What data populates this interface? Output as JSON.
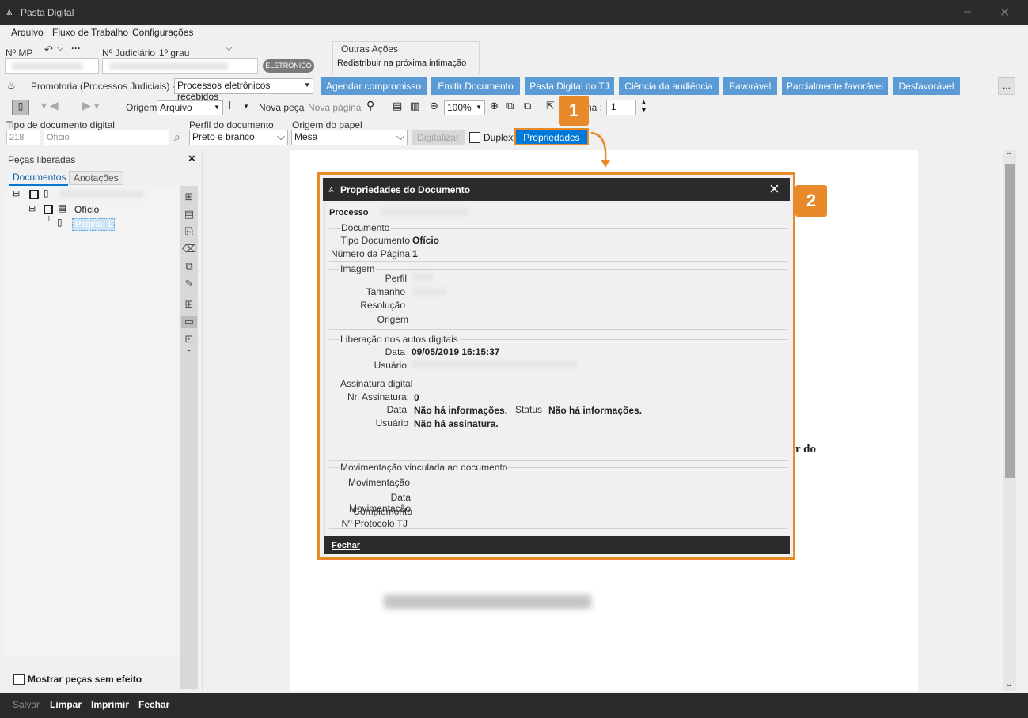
{
  "window": {
    "title": "Pasta Digital"
  },
  "menu": [
    "Arquivo",
    "Fluxo de Trabalho",
    "Configurações"
  ],
  "header": {
    "mp_label": "Nº MP",
    "judicial_label": "Nº Judiciário",
    "grau": "1º grau",
    "eletronico": "ELETRÔNICO",
    "outras_acoes_title": "Outras Ações",
    "outras_acoes_item": "Redistribuir na próxima intimação"
  },
  "queue": {
    "label": "Promotoria (Processos Judiciais) - Fila",
    "value": "Processos eletrônicos recebidos"
  },
  "actions": [
    "Agendar compromisso",
    "Emitir Documento",
    "Pasta Digital do TJ",
    "Ciência da audiência",
    "Favorável",
    "Parcialmente favorável",
    "Desfavorável"
  ],
  "more": "...",
  "toolbar": {
    "origem_label": "Origem",
    "origem_value": "Arquivo",
    "nova_peca": "Nova peça",
    "nova_pagina": "Nova página",
    "zoom": "100%",
    "pagina_label": "na :",
    "pagina_value": "1"
  },
  "docbar": {
    "tipo_label": "Tipo de documento digital",
    "tipo_code": "218",
    "tipo_value": "Ofício",
    "perfil_label": "Perfil do documento",
    "perfil_value": "Preto e branco",
    "origem_label": "Origem do papel",
    "origem_value": "Mesa",
    "digitalizar": "Digitalizar",
    "duplex": "Duplex",
    "propriedades": "Propriedades"
  },
  "sidebar": {
    "title": "Peças liberadas",
    "close": "×",
    "tabs": [
      "Documentos",
      "Anotações"
    ],
    "tree": {
      "child": "Ofício",
      "page": "Página: 1"
    },
    "mostrar": "Mostrar peças sem efeito"
  },
  "document": {
    "fragment": "r do"
  },
  "dialog": {
    "title": "Propriedades do Documento",
    "close": "×",
    "processo_label": "Processo",
    "documento": {
      "title": "Documento",
      "tipo_label": "Tipo Documento",
      "tipo_value": "Ofício",
      "numero_label": "Número da Página",
      "numero_value": "1"
    },
    "imagem": {
      "title": "Imagem",
      "perfil": "Perfil",
      "tamanho": "Tamanho",
      "resolucao": "Resolução",
      "origem": "Origem"
    },
    "liberacao": {
      "title": "Liberação nos autos digitais",
      "data_label": "Data",
      "data_value": "09/05/2019 16:15:37",
      "usuario_label": "Usuário"
    },
    "assinatura": {
      "title": "Assinatura digital",
      "nr_label": "Nr. Assinatura:",
      "nr_value": "0",
      "data_label": "Data",
      "data_value": "Não há informações.",
      "status_label": "Status",
      "status_value": "Não há informações.",
      "usuario_label": "Usuário",
      "usuario_value": "Não há assinatura."
    },
    "movimentacao": {
      "title": "Movimentação vinculada ao documento",
      "mov_label": "Movimentação",
      "data_label": "Data Movimentação",
      "comp_label": "Complemento",
      "prot_label": "Nº Protocolo TJ"
    },
    "fechar": "Fechar"
  },
  "markers": {
    "one": "1",
    "two": "2"
  },
  "statusbar": [
    "Salvar",
    "Limpar",
    "Imprimir",
    "Fechar"
  ],
  "colors": {
    "accent": "#5b9bd5",
    "orange": "#e8892a",
    "selected": "#0078d7",
    "dark": "#2b2b2b"
  }
}
